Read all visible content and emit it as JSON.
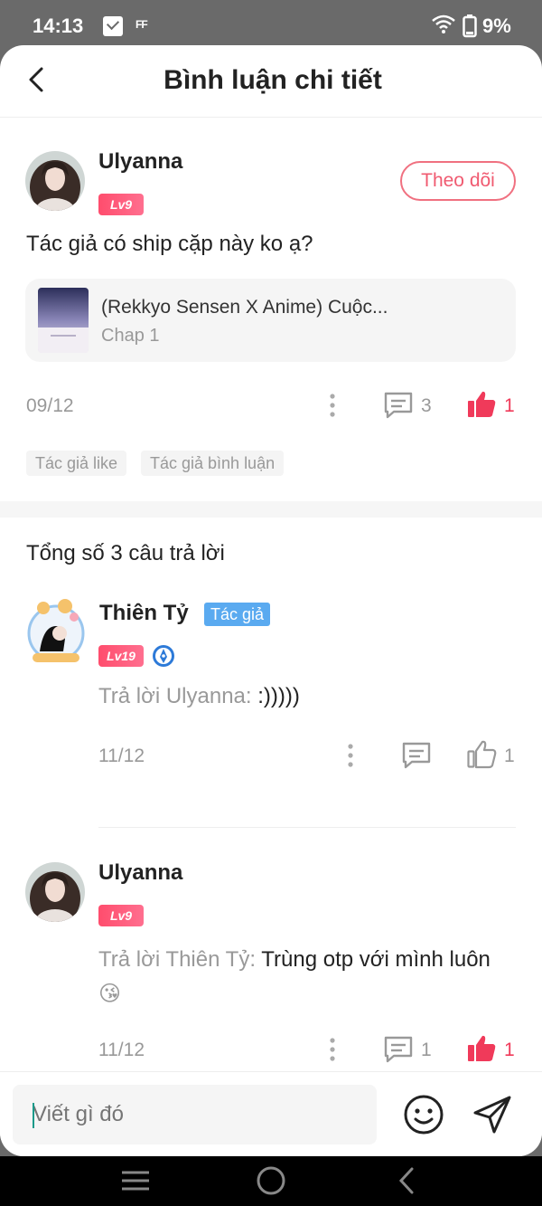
{
  "status": {
    "time": "14:13",
    "ff": "FF",
    "battery": "9%"
  },
  "header": {
    "title": "Bình luận chi tiết"
  },
  "main_comment": {
    "username": "Ulyanna",
    "level": "Lv9",
    "follow_label": "Theo dõi",
    "text": "Tác giả có ship cặp này ko ạ?",
    "story": {
      "title": "(Rekkyo Sensen X Anime) Cuộc...",
      "chapter": "Chap 1"
    },
    "date": "09/12",
    "reply_count": "3",
    "like_count": "1",
    "tags": [
      "Tác giả like",
      "Tác giả bình luận"
    ]
  },
  "replies_section": {
    "title": "Tổng số 3 câu trả lời"
  },
  "replies": [
    {
      "username": "Thiên Tỷ",
      "badge": "Tác giả",
      "level": "Lv19",
      "reply_prefix": "Trả lời Ulyanna:",
      "message": " :)))))",
      "date": "11/12",
      "like_count": "1"
    },
    {
      "username": "Ulyanna",
      "level": "Lv9",
      "reply_prefix": "Trả lời Thiên Tỷ:",
      "message": " Trùng otp với mình luôn",
      "emoji": "😘",
      "date": "11/12",
      "reply_count": "1",
      "like_count": "1"
    }
  ],
  "input": {
    "placeholder": "Viết gì đó"
  },
  "colors": {
    "accent": "#f03a5a",
    "author_badge": "#5aaaf0",
    "muted": "#999999"
  },
  "icons": [
    "back-icon",
    "more-icon",
    "comment-icon",
    "like-icon",
    "emoji-icon",
    "send-icon",
    "menu-icon",
    "home-icon",
    "nav-back-icon"
  ]
}
